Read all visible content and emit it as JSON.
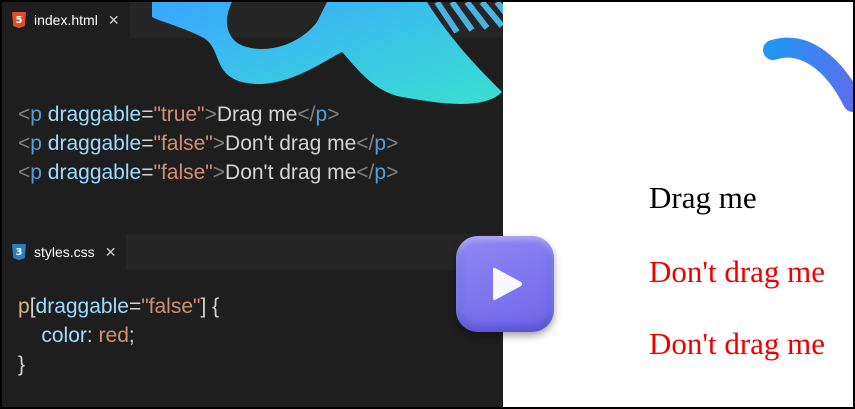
{
  "editor": {
    "html_tab": {
      "label": "index.html",
      "icon": "html5-icon",
      "close": "✕"
    },
    "css_tab": {
      "label": "styles.css",
      "icon": "css3-icon",
      "close": "✕"
    },
    "html_code": [
      {
        "tag_open": "<",
        "tag": "p",
        "attr": "draggable",
        "eq": "=",
        "value": "\"true\"",
        "gt": ">",
        "text": "Drag me",
        "close_open": "</",
        "close_tag": "p",
        "close_gt": ">"
      },
      {
        "tag_open": "<",
        "tag": "p",
        "attr": "draggable",
        "eq": "=",
        "value": "\"false\"",
        "gt": ">",
        "text": "Don't drag me",
        "close_open": "</",
        "close_tag": "p",
        "close_gt": ">"
      },
      {
        "tag_open": "<",
        "tag": "p",
        "attr": "draggable",
        "eq": "=",
        "value": "\"false\"",
        "gt": ">",
        "text": "Don't drag me",
        "close_open": "</",
        "close_tag": "p",
        "close_gt": ">"
      }
    ],
    "css_code": {
      "selector_tag": "p",
      "bracket_open": "[",
      "selector_attr": "draggable",
      "selector_eq": "=",
      "selector_value": "\"false\"",
      "bracket_close": "]",
      "brace_open": " {",
      "property": "color",
      "colon": ": ",
      "prop_value": "red",
      "semicolon": ";",
      "brace_close": "}"
    }
  },
  "preview": {
    "lines": [
      "Drag me",
      "Don't drag me",
      "Don't drag me"
    ],
    "colors": [
      "#000000",
      "#ee0000",
      "#ee0000"
    ]
  },
  "play_button": {
    "icon": "play-icon"
  },
  "colors": {
    "editor_bg": "#1e1e1e",
    "tag": "#569cd6",
    "attr": "#9cdcfe",
    "string": "#ce9178",
    "selector": "#d7ba7d",
    "accent": "#7b73ee"
  }
}
